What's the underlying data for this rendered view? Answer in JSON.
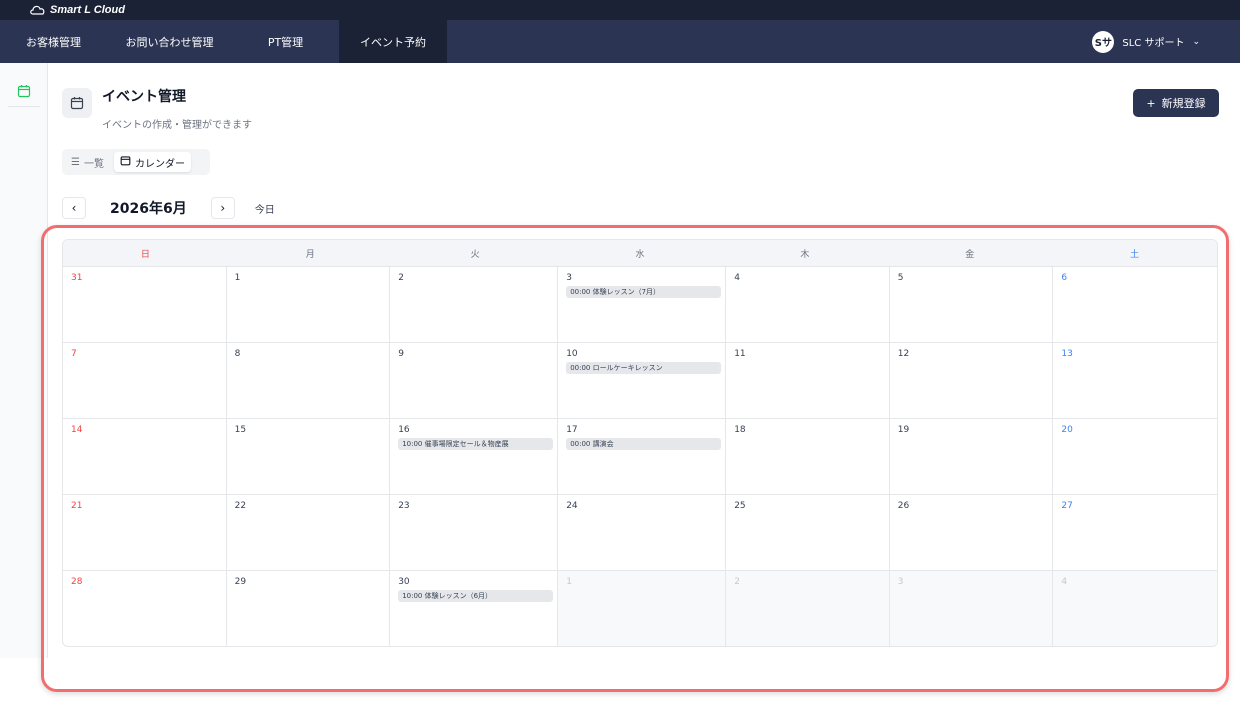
{
  "brand": {
    "name": "Smart L Cloud"
  },
  "nav": {
    "items": [
      {
        "label": "お客様管理",
        "active": false
      },
      {
        "label": "お問い合わせ管理",
        "active": false
      },
      {
        "label": "PT管理",
        "active": false
      },
      {
        "label": "イベント予約",
        "active": true
      }
    ],
    "user": {
      "avatar": "Sサ",
      "name": "SLC サポート"
    }
  },
  "page": {
    "title": "イベント管理",
    "subtitle": "イベントの作成・管理ができます",
    "new_button": "新規登録"
  },
  "view_toggle": {
    "list": "一覧",
    "calendar": "カレンダー"
  },
  "month_nav": {
    "title": "2026年6月",
    "prev": "‹",
    "next": "›",
    "today": "今日"
  },
  "calendar": {
    "weekdays": [
      "日",
      "月",
      "火",
      "水",
      "木",
      "金",
      "土"
    ],
    "days": [
      {
        "d": "31",
        "events": []
      },
      {
        "d": "1",
        "events": []
      },
      {
        "d": "2",
        "events": []
      },
      {
        "d": "3",
        "events": [
          "00:00 体験レッスン（7月）"
        ]
      },
      {
        "d": "4",
        "events": []
      },
      {
        "d": "5",
        "events": []
      },
      {
        "d": "6",
        "events": []
      },
      {
        "d": "7",
        "events": []
      },
      {
        "d": "8",
        "events": []
      },
      {
        "d": "9",
        "events": []
      },
      {
        "d": "10",
        "events": [
          "00:00 ロールケーキレッスン"
        ]
      },
      {
        "d": "11",
        "events": []
      },
      {
        "d": "12",
        "events": []
      },
      {
        "d": "13",
        "events": []
      },
      {
        "d": "14",
        "events": []
      },
      {
        "d": "15",
        "events": []
      },
      {
        "d": "16",
        "events": [
          "10:00 催事場限定セール＆物産展"
        ]
      },
      {
        "d": "17",
        "events": [
          "00:00 講演会"
        ]
      },
      {
        "d": "18",
        "events": []
      },
      {
        "d": "19",
        "events": []
      },
      {
        "d": "20",
        "events": []
      },
      {
        "d": "21",
        "events": []
      },
      {
        "d": "22",
        "events": []
      },
      {
        "d": "23",
        "events": []
      },
      {
        "d": "24",
        "events": []
      },
      {
        "d": "25",
        "events": []
      },
      {
        "d": "26",
        "events": []
      },
      {
        "d": "27",
        "events": []
      },
      {
        "d": "28",
        "events": []
      },
      {
        "d": "29",
        "events": []
      },
      {
        "d": "30",
        "events": [
          "10:00 体験レッスン（6月）"
        ]
      },
      {
        "d": "1",
        "events": [],
        "out": true
      },
      {
        "d": "2",
        "events": [],
        "out": true
      },
      {
        "d": "3",
        "events": [],
        "out": true
      },
      {
        "d": "4",
        "events": [],
        "out": true
      }
    ]
  },
  "colors": {
    "nav_bg": "#2b3453",
    "brand_bg": "#1c2236",
    "sunday": "#ef4444",
    "saturday": "#3b82f6",
    "highlight": "#f26d6d"
  }
}
